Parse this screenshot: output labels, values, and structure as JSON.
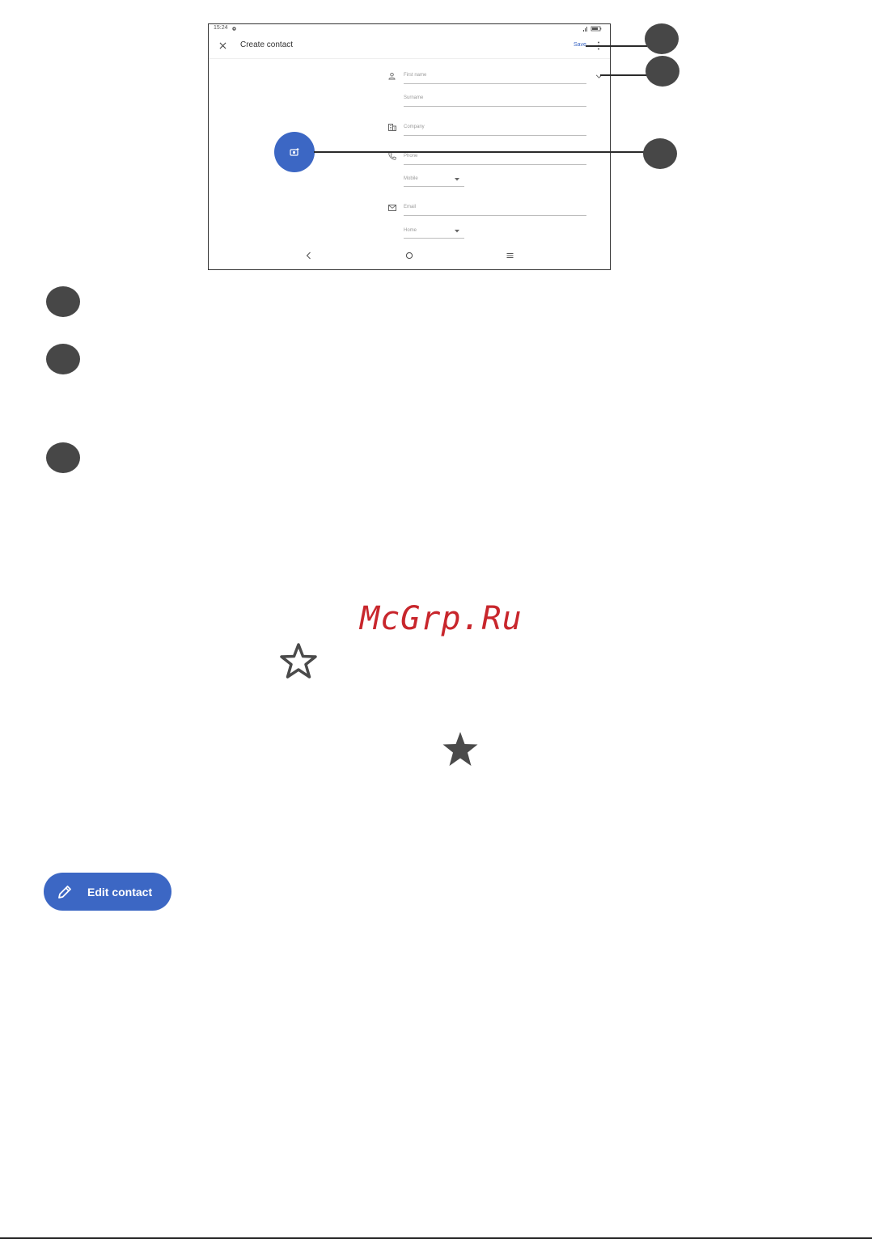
{
  "screen": {
    "status_time": "15:24",
    "title": "Create contact",
    "save_label": "Save",
    "fields": {
      "first_name": "First name",
      "surname": "Surname",
      "company": "Company",
      "phone": "Phone",
      "phone_type": "Mobile",
      "email": "Email",
      "email_type": "Home"
    }
  },
  "watermark": "McGrp.Ru",
  "edit_contact_label": "Edit contact",
  "icons": {
    "close": "close-icon",
    "more": "more-vert-icon",
    "expand": "chevron-down-icon",
    "person": "person-icon",
    "company": "building-icon",
    "phone": "phone-icon",
    "email": "mail-icon",
    "camera": "add-photo-icon",
    "star_outline": "star-outline-icon",
    "star_filled": "star-filled-icon",
    "pencil": "pencil-icon"
  },
  "colors": {
    "accent": "#3c67c4",
    "watermark": "#c8262c",
    "callout": "#474747"
  }
}
